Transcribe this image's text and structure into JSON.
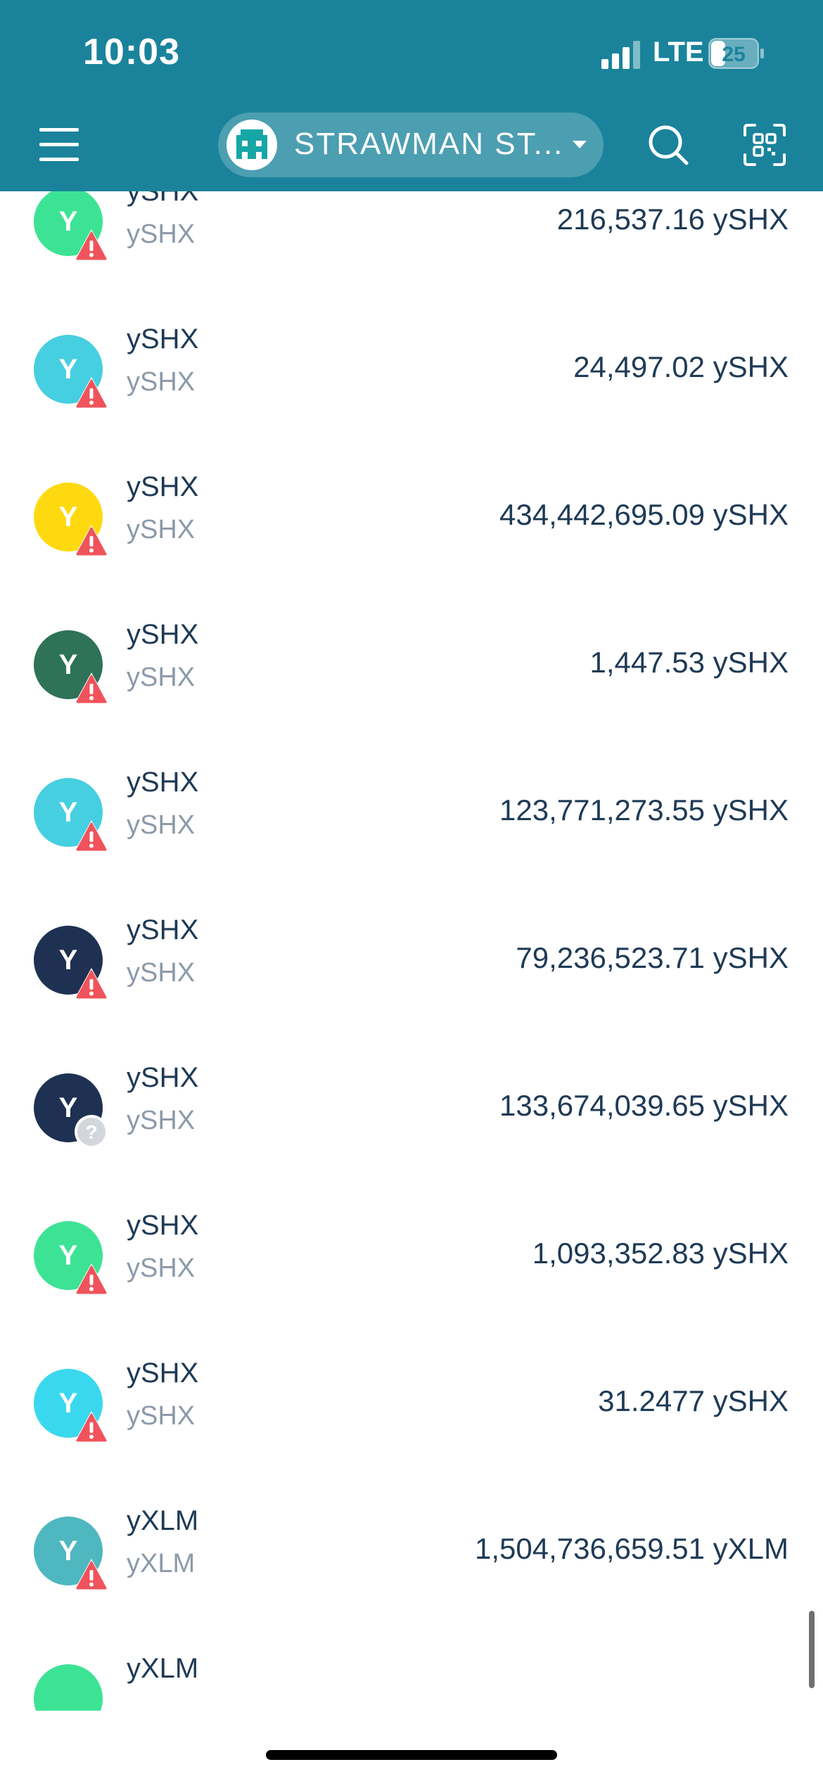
{
  "status_bar": {
    "time": "10:03",
    "network": "LTE",
    "battery": "25"
  },
  "header": {
    "account_name": "STRAWMAN ST...",
    "icons": {
      "menu": "hamburger-menu-icon",
      "search": "search-icon",
      "scan": "qr-scan-icon",
      "account": "pixel-avatar-icon",
      "caret": "caret-down-icon"
    }
  },
  "tokens": [
    {
      "name": "ySHX",
      "code": "ySHX",
      "amount": "216,537.16 ySHX",
      "avatar_color": "#3de395",
      "avatar_letter": "Y",
      "badge": "warning"
    },
    {
      "name": "ySHX",
      "code": "ySHX",
      "amount": "24,497.02 ySHX",
      "avatar_color": "#46cfe0",
      "avatar_letter": "Y",
      "badge": "warning"
    },
    {
      "name": "ySHX",
      "code": "ySHX",
      "amount": "434,442,695.09 ySHX",
      "avatar_color": "#ffd90f",
      "avatar_letter": "Y",
      "badge": "warning"
    },
    {
      "name": "ySHX",
      "code": "ySHX",
      "amount": "1,447.53 ySHX",
      "avatar_color": "#2e7258",
      "avatar_letter": "Y",
      "badge": "warning"
    },
    {
      "name": "ySHX",
      "code": "ySHX",
      "amount": "123,771,273.55 ySHX",
      "avatar_color": "#46cfe0",
      "avatar_letter": "Y",
      "badge": "warning"
    },
    {
      "name": "ySHX",
      "code": "ySHX",
      "amount": "79,236,523.71 ySHX",
      "avatar_color": "#1f3152",
      "avatar_letter": "Y",
      "badge": "warning"
    },
    {
      "name": "ySHX",
      "code": "ySHX",
      "amount": "133,674,039.65 ySHX",
      "avatar_color": "#1f3152",
      "avatar_letter": "Y",
      "badge": "unknown"
    },
    {
      "name": "ySHX",
      "code": "ySHX",
      "amount": "1,093,352.83 ySHX",
      "avatar_color": "#3de395",
      "avatar_letter": "Y",
      "badge": "warning"
    },
    {
      "name": "ySHX",
      "code": "ySHX",
      "amount": "31.2477 ySHX",
      "avatar_color": "#3ad8ee",
      "avatar_letter": "Y",
      "badge": "warning"
    },
    {
      "name": "yXLM",
      "code": "yXLM",
      "amount": "1,504,736,659.51 yXLM",
      "avatar_color": "#4fb7bf",
      "avatar_letter": "Y",
      "badge": "warning"
    },
    {
      "name": "yXLM",
      "code": "",
      "amount": "",
      "avatar_color": "#3de395",
      "avatar_letter": "",
      "badge": "none"
    }
  ]
}
